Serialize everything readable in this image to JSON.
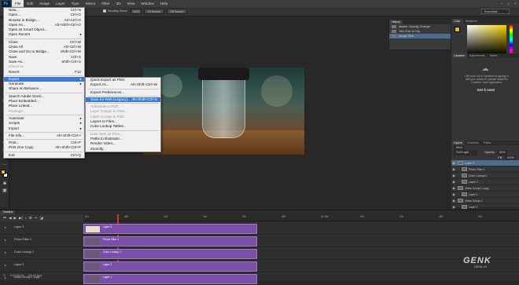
{
  "menubar": {
    "items": [
      "File",
      "Edit",
      "Image",
      "Layer",
      "Type",
      "Select",
      "Filter",
      "3D",
      "View",
      "Window",
      "Help"
    ],
    "active": "File",
    "win_controls": [
      "–",
      "□",
      "×"
    ]
  },
  "options": {
    "scrubby_zoom": "Scrubby Zoom",
    "btn_100": "100%",
    "fit_screen": "Fit Screen",
    "fill_screen": "Fill Screen",
    "workspace": "Essentials"
  },
  "file_menu": [
    {
      "label": "New...",
      "sc": "Ctrl+N"
    },
    {
      "label": "Open...",
      "sc": "Ctrl+O"
    },
    {
      "label": "Browse in Bridge...",
      "sc": "Alt+Ctrl+O"
    },
    {
      "label": "Open As...",
      "sc": "Alt+Shift+Ctrl+O"
    },
    {
      "label": "Open as Smart Object...",
      "sc": ""
    },
    {
      "label": "Open Recent",
      "sc": "",
      "sub": true
    },
    {
      "sep": true
    },
    {
      "label": "Close",
      "sc": "Ctrl+W"
    },
    {
      "label": "Close All",
      "sc": "Alt+Ctrl+W"
    },
    {
      "label": "Close and Go to Bridge...",
      "sc": "Shift+Ctrl+W"
    },
    {
      "label": "Save",
      "sc": "Ctrl+S"
    },
    {
      "label": "Save As...",
      "sc": "Shift+Ctrl+S"
    },
    {
      "label": "Check In...",
      "sc": "",
      "dis": true
    },
    {
      "label": "Revert",
      "sc": "F12"
    },
    {
      "sep": true
    },
    {
      "label": "Export",
      "sc": "",
      "sub": true,
      "hl": true
    },
    {
      "label": "Generate",
      "sc": "",
      "sub": true
    },
    {
      "label": "Share on Behance...",
      "sc": ""
    },
    {
      "sep": true
    },
    {
      "label": "Search Adobe Stock...",
      "sc": ""
    },
    {
      "label": "Place Embedded...",
      "sc": ""
    },
    {
      "label": "Place Linked...",
      "sc": ""
    },
    {
      "label": "Package...",
      "sc": "",
      "dis": true
    },
    {
      "sep": true
    },
    {
      "label": "Automate",
      "sc": "",
      "sub": true
    },
    {
      "label": "Scripts",
      "sc": "",
      "sub": true
    },
    {
      "label": "Import",
      "sc": "",
      "sub": true
    },
    {
      "sep": true
    },
    {
      "label": "File Info...",
      "sc": "Alt+Shift+Ctrl+I"
    },
    {
      "sep": true
    },
    {
      "label": "Print...",
      "sc": "Ctrl+P"
    },
    {
      "label": "Print One Copy",
      "sc": "Alt+Shift+Ctrl+P"
    },
    {
      "sep": true
    },
    {
      "label": "Exit",
      "sc": "Ctrl+Q"
    }
  ],
  "export_menu": [
    {
      "label": "Quick Export as PNG",
      "sc": ""
    },
    {
      "label": "Export As...",
      "sc": "Alt+Shift+Ctrl+W"
    },
    {
      "sep": true
    },
    {
      "label": "Export Preferences...",
      "sc": ""
    },
    {
      "sep": true
    },
    {
      "label": "Save for Web (Legacy)...",
      "sc": "Alt+Shift+Ctrl+S",
      "hl": true
    },
    {
      "sep": true
    },
    {
      "label": "Artboards to PDF...",
      "sc": "",
      "dis": true
    },
    {
      "label": "Layer Comps to Files...",
      "sc": "",
      "dis": true
    },
    {
      "label": "Layer Comps to PDF...",
      "sc": "",
      "dis": true
    },
    {
      "label": "Layers to Files...",
      "sc": ""
    },
    {
      "label": "Color Lookup Tables...",
      "sc": ""
    },
    {
      "sep": true
    },
    {
      "label": "Data Sets as Files...",
      "sc": "",
      "dis": true
    },
    {
      "label": "Paths to Illustrator...",
      "sc": ""
    },
    {
      "label": "Render Video...",
      "sc": ""
    },
    {
      "label": "Zoomify...",
      "sc": ""
    }
  ],
  "history": {
    "title": "History",
    "items": [
      "Master Opacity Change",
      "Trim End of Clip",
      "Image Size"
    ]
  },
  "color_panel": {
    "tabs": [
      "Color",
      "Swatches"
    ]
  },
  "libraries": {
    "tabs": [
      "Libraries",
      "Adjustments",
      "Styles"
    ],
    "message": "Get more out of Libraries by signing in with your Adobe ID, please install the Creative Cloud application.",
    "link": "Get it now!"
  },
  "layers_panel": {
    "tabs": [
      "Layers",
      "Channels",
      "Paths"
    ],
    "kind": "Kind",
    "blend": "Soft Light",
    "opacity_label": "Opacity:",
    "opacity": "60%",
    "fill_label": "Fill:",
    "fill": "100%",
    "rows": [
      {
        "name": "Layer 3",
        "sel": true,
        "indent": 0
      },
      {
        "name": "Photo Filter 1",
        "indent": 1
      },
      {
        "name": "Color Lookup 1",
        "indent": 1
      },
      {
        "name": "Layer 2",
        "indent": 1
      },
      {
        "name": "Video Group 1 copy",
        "indent": 0
      },
      {
        "name": "Layer 1",
        "indent": 1
      },
      {
        "name": "Video Group 1",
        "indent": 0
      },
      {
        "name": "Layer 1",
        "indent": 1
      }
    ]
  },
  "timeline": {
    "title": "Timeline",
    "timecode": "0:00:00:18",
    "fps": "(30.00 fps)",
    "zoom_label": "Zoom: 194.34(1.2fr)",
    "ruler": [
      "01f",
      "05f",
      "10f",
      "15f",
      "20f",
      "25f",
      "01:00f",
      "05f",
      "10f",
      "15f",
      "20f"
    ],
    "tracks": [
      {
        "name": "Layer 3",
        "clip": "Layer 3"
      },
      {
        "name": "Photo Filter 1",
        "clip": "Photo Filter 1"
      },
      {
        "name": "Color Lookup 1",
        "clip": "Color Lookup 1"
      },
      {
        "name": "Layer 2",
        "clip": "Layer 2"
      },
      {
        "name": "Video Group 1 copy",
        "clip": "Layer 1"
      }
    ]
  },
  "watermark": {
    "brand": "GENK",
    "sub": "GENK.VN"
  },
  "colors": {
    "accent": "#3c79d1",
    "clip": "#7a4fa8",
    "playhead": "#e03030",
    "fg_swatch": "#e8c000"
  }
}
